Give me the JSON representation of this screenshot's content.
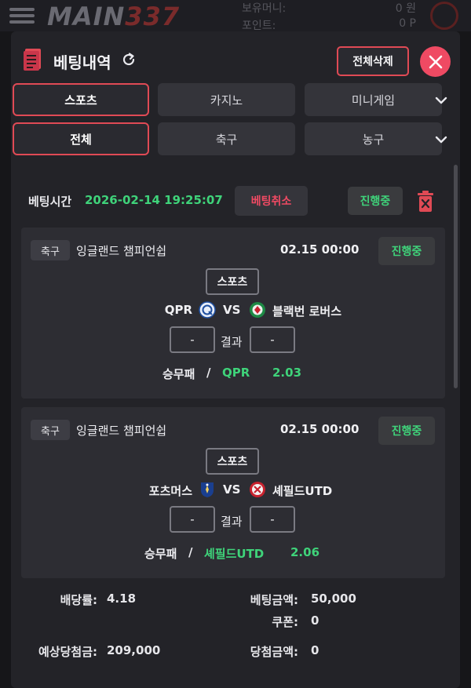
{
  "background": {
    "logo_main": "MAIN",
    "logo_num": "337",
    "label_money": "보유머니:",
    "value_money": "0 원",
    "label_point": "포인트:",
    "value_point": "0 P"
  },
  "modal": {
    "title": "베팅내역",
    "delete_all_label": "전체삭제",
    "category_tabs": [
      {
        "label": "스포츠",
        "active": true
      },
      {
        "label": "카지노",
        "active": false
      },
      {
        "label": "미니게임",
        "active": false
      }
    ],
    "sport_tabs": [
      {
        "label": "전체",
        "active": true
      },
      {
        "label": "축구",
        "active": false
      },
      {
        "label": "농구",
        "active": false
      }
    ]
  },
  "bet": {
    "time_label": "베팅시간",
    "time_value": "2026-02-14 19:25:07",
    "cancel_label": "베팅취소",
    "status": "진행중",
    "matches": [
      {
        "sport_badge": "축구",
        "league": "잉글랜드 챔피언쉽",
        "time": "02.15 00:00",
        "status": "진행중",
        "type_tag": "스포츠",
        "home": "QPR",
        "vs": "VS",
        "away": "블랙번 로버스",
        "home_score": "-",
        "result_label": "결과",
        "away_score": "-",
        "market": "승무패",
        "separator": "/",
        "pick": "QPR",
        "odds": "2.03"
      },
      {
        "sport_badge": "축구",
        "league": "잉글랜드 챔피언쉽",
        "time": "02.15 00:00",
        "status": "진행중",
        "type_tag": "스포츠",
        "home": "포츠머스",
        "vs": "VS",
        "away": "셰필드UTD",
        "home_score": "-",
        "result_label": "결과",
        "away_score": "-",
        "market": "승무패",
        "separator": "/",
        "pick": "셰필드UTD",
        "odds": "2.06"
      }
    ],
    "summary": {
      "odds_label": "배당률:",
      "odds_value": "4.18",
      "amount_label": "베팅금액:",
      "amount_value": "50,000",
      "coupon_label": "쿠폰:",
      "coupon_value": "0",
      "expected_label": "예상당첨금:",
      "expected_value": "209,000",
      "win_label": "당첨금액:",
      "win_value": "0"
    }
  },
  "colors": {
    "accent": "#e04a55",
    "close": "#ef4a63",
    "positive": "#3fd37a",
    "panel": "#232328",
    "card": "#2d2d33"
  }
}
